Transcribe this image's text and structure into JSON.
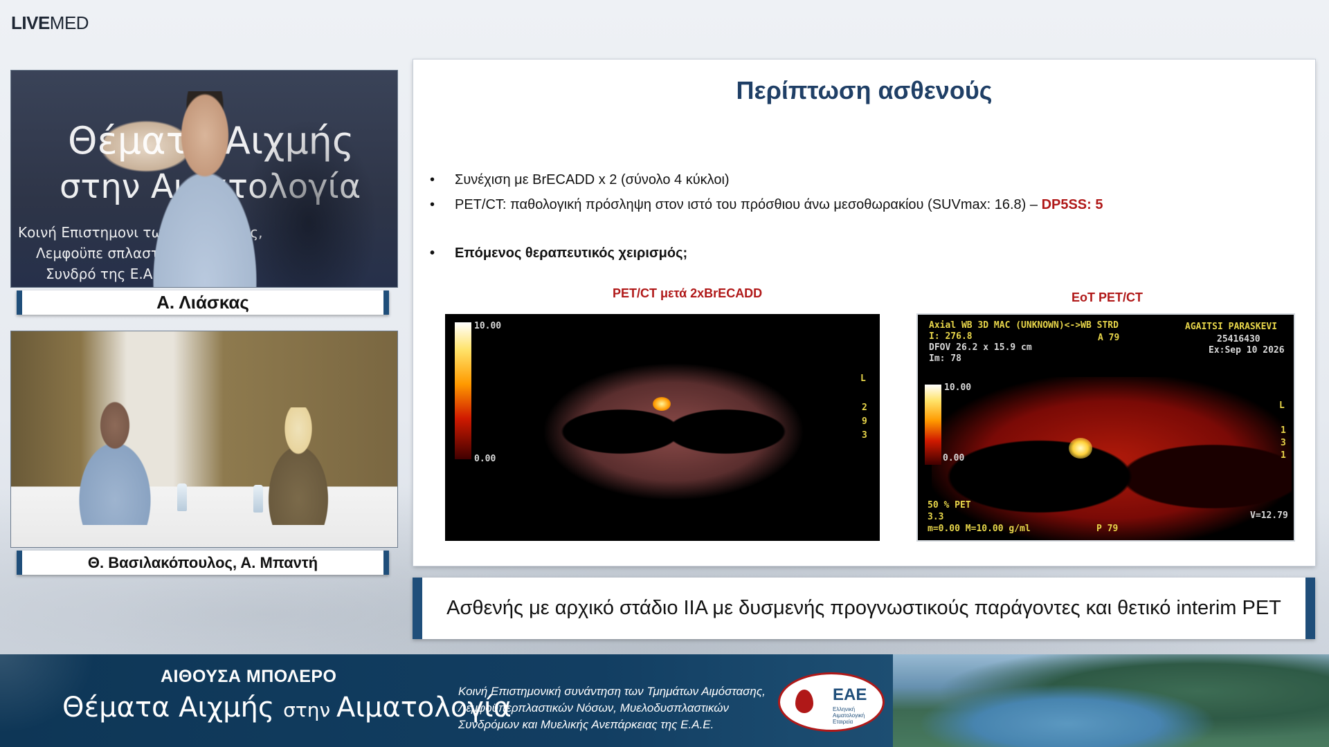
{
  "brand": {
    "live": "LIVE",
    "med": "MED"
  },
  "feeds": {
    "speaker_backdrop": {
      "line1": "Θέματα Αιχμής",
      "line2": "στην Αιματολογία",
      "line3": "Κοινή Επιστημονι            των Αιμόστασης,",
      "line4": "Λεμφοϋπε               σπλαστικών",
      "line5": "Συνδρό                 της Ε.Α.Ε."
    },
    "speaker_name": "Α. Λιάσκας",
    "panel_names": "Θ. Βασιλακόπουλος, Α. Μπαντή"
  },
  "slide": {
    "title": "Περίπτωση ασθενούς",
    "bullets": [
      {
        "marker": "•",
        "text": "Συνέχιση με BrECADD x 2 (σύνολο 4 κύκλοι)"
      },
      {
        "marker": "•",
        "text": "PET/CT:  παθολογική πρόσληψη στον ιστό του πρόσθιου άνω μεσοθωρακίου (SUVmax: 16.8) – ",
        "highlight": "DP5SS: 5"
      },
      {
        "marker": "•",
        "text": "Επόμενος θεραπευτικός χειρισμός;"
      }
    ],
    "image1": {
      "caption": "PET/CT μετά 2xBrECADD",
      "scale_max": "10.00",
      "scale_min": "0.00",
      "side_letters": [
        "L",
        "2",
        "9",
        "3"
      ]
    },
    "image2": {
      "caption": "EoT PET/CT",
      "header_left": [
        "Axial WB 3D MAC (UNKNOWN)<->WB STRD",
        "I: 276.8",
        "DFOV 26.2 x 15.9 cm",
        "Im: 78"
      ],
      "header_mid": "A 79",
      "header_right": [
        "AGAITSI PARASKEVI",
        "25416430",
        "Ex:Sep 10 2026"
      ],
      "scale_max": "10.00",
      "scale_min": "0.00",
      "side_letters": [
        "L",
        "1",
        "3",
        "1"
      ],
      "footer_left": [
        "50 % PET",
        "3.3",
        "m=0.00 M=10.00 g/ml"
      ],
      "footer_mid": "P 79",
      "footer_right": "V=12.79"
    }
  },
  "caption": "Ασθενής με αρχικό στάδιο ΙΙΑ με δυσμενής προγνωστικούς παράγοντες και θετικό interim PET",
  "band": {
    "hall": "ΑΙΘΟΥΣΑ ΜΠΟΛΕΡΟ",
    "title_part1": "Θέματα Αιχμής ",
    "title_part2": "στην ",
    "title_part3": "Αιματολογία",
    "description": [
      "Κοινή Επιστημονική συνάντηση των Τμημάτων Αιμόστασης,",
      "Λεμφοϋπερπλαστικών Νόσων, Μυελοδυσπλαστικών",
      "Συνδρόμων και Μυελικής Ανεπάρκειας της Ε.Α.Ε."
    ],
    "logo_letters": "ΕΑΕ",
    "logo_sub": [
      "Ελληνική",
      "Αιματολογική",
      "Εταιρεία"
    ]
  },
  "colors": {
    "accent_blue": "#1f4e7a",
    "title_blue": "#1f3f66",
    "highlight_red": "#b01818"
  }
}
